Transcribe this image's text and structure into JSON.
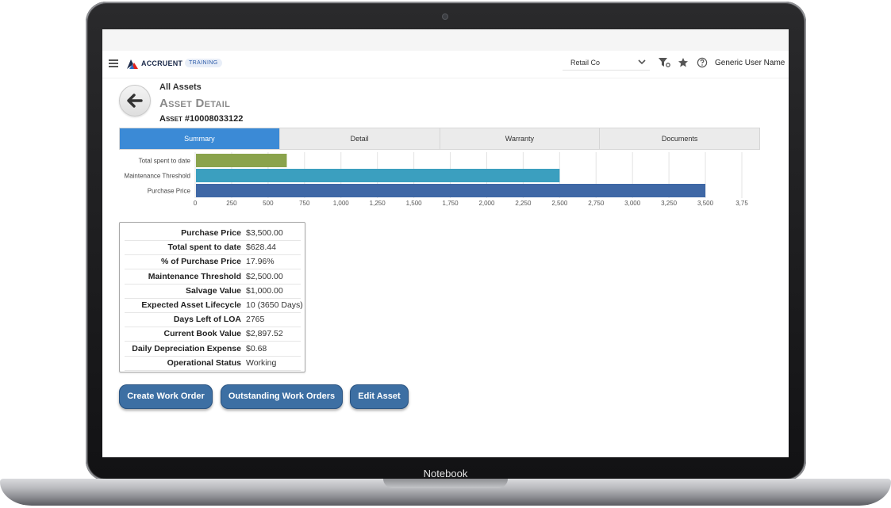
{
  "device": {
    "bezel_label": "Notebook"
  },
  "header": {
    "brand": "ACCRUENT",
    "badge": "TRAINING",
    "company": "Retail Co",
    "user_name": "Generic User Name",
    "icons": [
      "menu-icon",
      "filter-settings-icon",
      "star-icon",
      "help-icon",
      "chevron-down-icon"
    ]
  },
  "breadcrumb": "All Assets",
  "page_title": "Asset Detail",
  "asset_number": "Asset #10008033122",
  "tabs": [
    {
      "label": "Summary",
      "active": true
    },
    {
      "label": "Detail",
      "active": false
    },
    {
      "label": "Warranty",
      "active": false
    },
    {
      "label": "Documents",
      "active": false
    }
  ],
  "chart_data": {
    "type": "bar",
    "orientation": "horizontal",
    "categories": [
      "Total spent to date",
      "Maintenance Threshold",
      "Purchase Price"
    ],
    "values": [
      628.44,
      2500,
      3500
    ],
    "colors": [
      "#8aa34c",
      "#3b9fbf",
      "#3f68a6"
    ],
    "x_ticks": [
      "0",
      "250",
      "500",
      "750",
      "1,000",
      "1,250",
      "1,500",
      "1,750",
      "2,000",
      "2,250",
      "2,500",
      "2,750",
      "3,000",
      "3,250",
      "3,500",
      "3,75"
    ],
    "xlim": [
      0,
      3750
    ],
    "grid": true
  },
  "summary": [
    {
      "label": "Purchase Price",
      "value": "$3,500.00"
    },
    {
      "label": "Total spent to date",
      "value": "$628.44"
    },
    {
      "label": "% of Purchase Price",
      "value": "17.96%"
    },
    {
      "label": "Maintenance Threshold",
      "value": "$2,500.00"
    },
    {
      "label": "Salvage Value",
      "value": "$1,000.00"
    },
    {
      "label": "Expected Asset Lifecycle",
      "value": "10 (3650 Days)"
    },
    {
      "label": "Days Left of LOA",
      "value": "2765"
    },
    {
      "label": "Current Book Value",
      "value": "$2,897.52"
    },
    {
      "label": "Daily Depreciation Expense",
      "value": "$0.68"
    },
    {
      "label": "Operational Status",
      "value": "Working"
    }
  ],
  "actions": {
    "create_work_order": "Create Work Order",
    "outstanding_work_orders": "Outstanding Work Orders",
    "edit_asset": "Edit Asset"
  },
  "colors": {
    "accent": "#3b8ad6",
    "button": "#3d6fa3"
  }
}
